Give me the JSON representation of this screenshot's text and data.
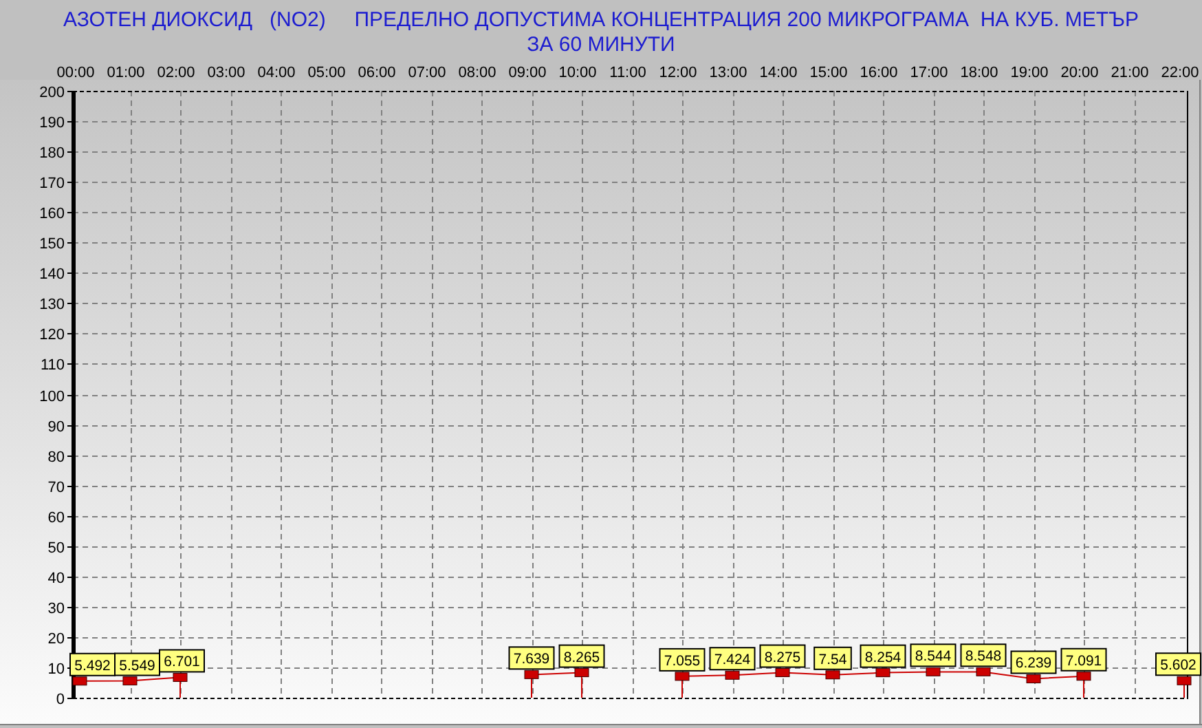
{
  "chart": {
    "chart_data": {
      "type": "line",
      "title": "АЗОТЕН ДИОКСИД   (NO2)     ПРЕДЕЛНО ДОПУСТИМА КОНЦЕНТРАЦИЯ 200 МИКРОГРАМА  НА КУБ. МЕТЪР ЗА 60 МИНУТИ",
      "categories": [
        "00:00",
        "01:00",
        "02:00",
        "03:00",
        "04:00",
        "05:00",
        "06:00",
        "07:00",
        "08:00",
        "09:00",
        "10:00",
        "11:00",
        "12:00",
        "13:00",
        "14:00",
        "15:00",
        "16:00",
        "17:00",
        "18:00",
        "19:00",
        "20:00",
        "21:00",
        "22:00"
      ],
      "series": [
        {
          "color": "#cc0000",
          "marker": "square",
          "values": [
            5.492,
            5.549,
            6.701,
            null,
            null,
            null,
            null,
            null,
            null,
            7.639,
            8.265,
            null,
            7.055,
            7.424,
            8.275,
            7.54,
            8.254,
            8.544,
            8.548,
            6.239,
            7.091,
            null,
            5.602
          ]
        }
      ],
      "ylim": [
        0,
        200
      ],
      "yticks": [
        0,
        10,
        20,
        30,
        40,
        50,
        60,
        70,
        80,
        90,
        100,
        110,
        120,
        130,
        140,
        150,
        160,
        170,
        180,
        190,
        200
      ],
      "grid": true,
      "data_labels": true
    }
  }
}
